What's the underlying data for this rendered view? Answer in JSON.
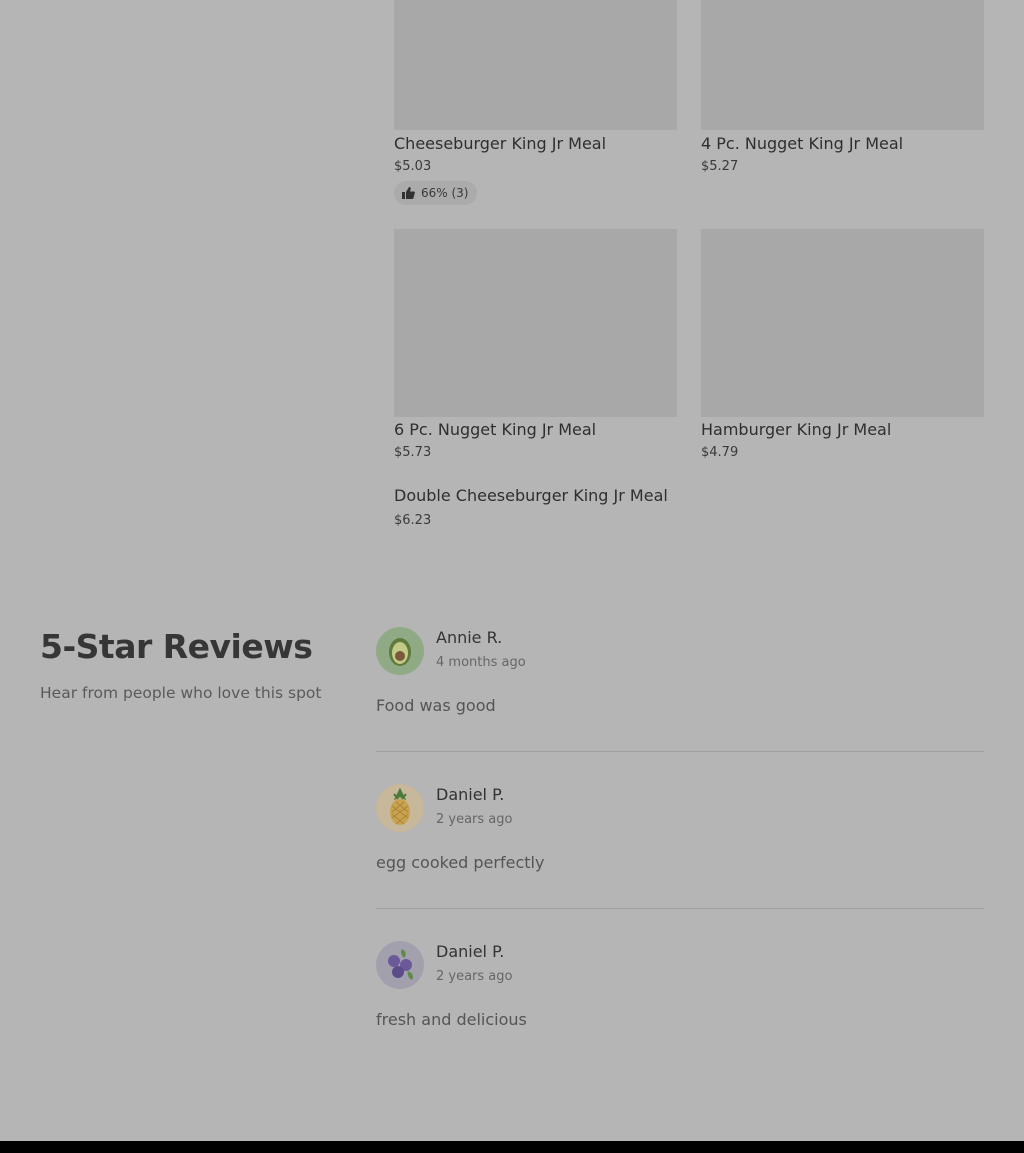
{
  "menu": {
    "items": [
      {
        "title": "Cheeseburger King Jr Meal",
        "price": "$5.03",
        "rating": "66% (3)"
      },
      {
        "title": "4 Pc. Nugget King Jr Meal",
        "price": "$5.27"
      },
      {
        "title": "6 Pc. Nugget King Jr Meal",
        "price": "$5.73"
      },
      {
        "title": "Hamburger King Jr Meal",
        "price": "$4.79"
      },
      {
        "title": "Double Cheeseburger King Jr Meal",
        "price": "$6.23"
      }
    ]
  },
  "reviews": {
    "title": "5-Star Reviews",
    "subtitle": "Hear from people who love this spot",
    "items": [
      {
        "name": "Annie R.",
        "date": "4 months ago",
        "text": "Food was good",
        "avatar_icon": "avocado-icon"
      },
      {
        "name": "Daniel P.",
        "date": "2 years ago",
        "text": "egg cooked perfectly",
        "avatar_icon": "pineapple-icon"
      },
      {
        "name": "Daniel P.",
        "date": "2 years ago",
        "text": "fresh and delicious",
        "avatar_icon": "blueberries-icon"
      }
    ]
  },
  "colors": {
    "overlay_background": "#b5b5b5",
    "image_placeholder": "#a8a8a8",
    "footer": "#000000"
  }
}
